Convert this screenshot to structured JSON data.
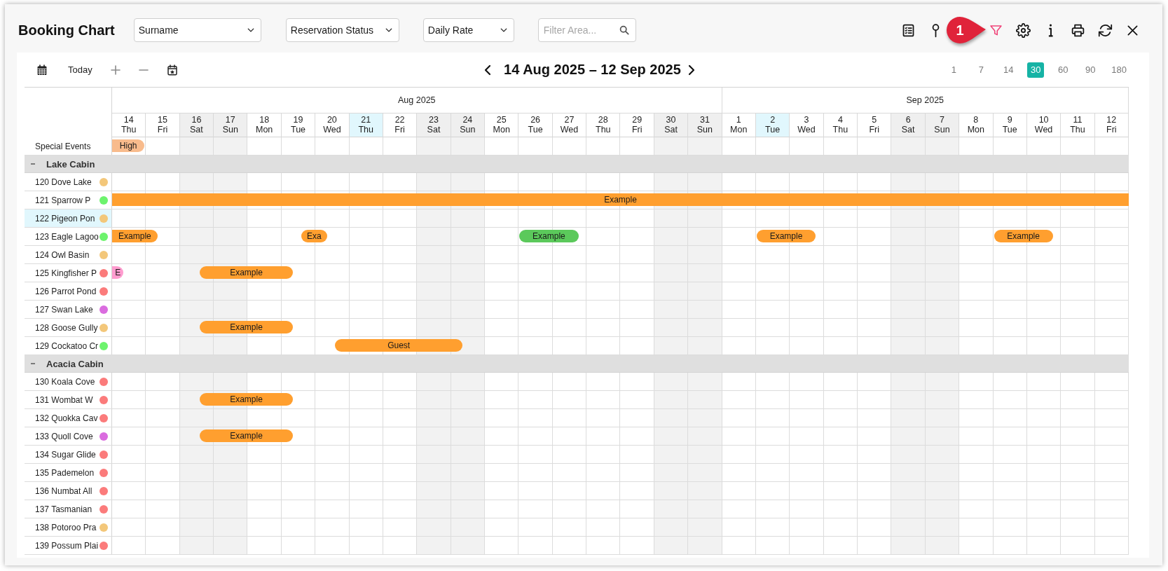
{
  "header": {
    "title": "Booking Chart",
    "dropdowns": [
      {
        "value": "Surname"
      },
      {
        "value": "Reservation Status"
      },
      {
        "value": "Daily Rate"
      }
    ],
    "filter": {
      "placeholder": "Filter Area..."
    },
    "tools": [
      {
        "kind": "checklist",
        "active": false
      },
      {
        "kind": "pin",
        "active": false
      },
      {
        "kind": "filter",
        "active": true,
        "callout": "1"
      },
      {
        "kind": "settings",
        "active": false
      },
      {
        "kind": "info",
        "active": false
      },
      {
        "kind": "print",
        "active": false
      },
      {
        "kind": "refresh",
        "active": false
      },
      {
        "kind": "close",
        "active": false
      }
    ]
  },
  "toolbar": {
    "today": "Today",
    "range": "14 Aug 2025 – 12 Sep 2025",
    "spans": [
      {
        "label": "1",
        "selected": false
      },
      {
        "label": "7",
        "selected": false
      },
      {
        "label": "14",
        "selected": false
      },
      {
        "label": "30",
        "selected": true
      },
      {
        "label": "60",
        "selected": false
      },
      {
        "label": "90",
        "selected": false
      },
      {
        "label": "180",
        "selected": false
      }
    ]
  },
  "chart": {
    "months": [
      {
        "label": "Aug 2025",
        "days": [
          {
            "day": "14",
            "weekday": "Thu",
            "weekend": false,
            "highlighted": false
          },
          {
            "day": "15",
            "weekday": "Fri",
            "weekend": false,
            "highlighted": false
          },
          {
            "day": "16",
            "weekday": "Sat",
            "weekend": true,
            "highlighted": false
          },
          {
            "day": "17",
            "weekday": "Sun",
            "weekend": true,
            "highlighted": false
          },
          {
            "day": "18",
            "weekday": "Mon",
            "weekend": false,
            "highlighted": false
          },
          {
            "day": "19",
            "weekday": "Tue",
            "weekend": false,
            "highlighted": false
          },
          {
            "day": "20",
            "weekday": "Wed",
            "weekend": false,
            "highlighted": false
          },
          {
            "day": "21",
            "weekday": "Thu",
            "weekend": false,
            "highlighted": true
          },
          {
            "day": "22",
            "weekday": "Fri",
            "weekend": false,
            "highlighted": false
          },
          {
            "day": "23",
            "weekday": "Sat",
            "weekend": true,
            "highlighted": false
          },
          {
            "day": "24",
            "weekday": "Sun",
            "weekend": true,
            "highlighted": false
          },
          {
            "day": "25",
            "weekday": "Mon",
            "weekend": false,
            "highlighted": false
          },
          {
            "day": "26",
            "weekday": "Tue",
            "weekend": false,
            "highlighted": false
          },
          {
            "day": "27",
            "weekday": "Wed",
            "weekend": false,
            "highlighted": false
          },
          {
            "day": "28",
            "weekday": "Thu",
            "weekend": false,
            "highlighted": false
          },
          {
            "day": "29",
            "weekday": "Fri",
            "weekend": false,
            "highlighted": false
          },
          {
            "day": "30",
            "weekday": "Sat",
            "weekend": true,
            "highlighted": false
          },
          {
            "day": "31",
            "weekday": "Sun",
            "weekend": true,
            "highlighted": false
          }
        ]
      },
      {
        "label": "Sep 2025",
        "days": [
          {
            "day": "1",
            "weekday": "Mon",
            "weekend": false,
            "highlighted": false
          },
          {
            "day": "2",
            "weekday": "Tue",
            "weekend": false,
            "highlighted": true
          },
          {
            "day": "3",
            "weekday": "Wed",
            "weekend": false,
            "highlighted": false
          },
          {
            "day": "4",
            "weekday": "Thu",
            "weekend": false,
            "highlighted": false
          },
          {
            "day": "5",
            "weekday": "Fri",
            "weekend": false,
            "highlighted": false
          },
          {
            "day": "6",
            "weekday": "Sat",
            "weekend": true,
            "highlighted": false
          },
          {
            "day": "7",
            "weekday": "Sun",
            "weekend": true,
            "highlighted": false
          },
          {
            "day": "8",
            "weekday": "Mon",
            "weekend": false,
            "highlighted": false
          },
          {
            "day": "9",
            "weekday": "Tue",
            "weekend": false,
            "highlighted": false
          },
          {
            "day": "10",
            "weekday": "Wed",
            "weekend": false,
            "highlighted": false
          },
          {
            "day": "11",
            "weekday": "Thu",
            "weekend": false,
            "highlighted": false
          },
          {
            "day": "12",
            "weekday": "Fri",
            "weekend": false,
            "highlighted": false
          }
        ]
      }
    ],
    "special_events": {
      "label": "Special Events",
      "cells": [
        {
          "kind": "day_end",
          "label": "High",
          "color": "#f8bb8c"
        },
        {
          "kind": "free"
        },
        {
          "kind": "free"
        },
        {
          "kind": "free"
        },
        {
          "kind": "free"
        },
        {
          "kind": "free"
        },
        {
          "kind": "free"
        },
        {
          "kind": "free"
        },
        {
          "kind": "free"
        },
        {
          "kind": "free"
        },
        {
          "kind": "free"
        },
        {
          "kind": "free"
        },
        {
          "kind": "free"
        },
        {
          "kind": "free"
        },
        {
          "kind": "free"
        },
        {
          "kind": "free"
        },
        {
          "kind": "free"
        },
        {
          "kind": "free"
        },
        {
          "kind": "free"
        },
        {
          "kind": "free"
        },
        {
          "kind": "free"
        },
        {
          "kind": "free"
        },
        {
          "kind": "free"
        },
        {
          "kind": "free"
        },
        {
          "kind": "free"
        },
        {
          "kind": "free"
        },
        {
          "kind": "free"
        },
        {
          "kind": "free"
        },
        {
          "kind": "free"
        },
        {
          "kind": "free"
        }
      ]
    },
    "groups": [
      {
        "name": "Lake Cabin",
        "expanded": true,
        "rooms": [
          {
            "name": "120 Dove Lake",
            "color": "#f3c77a",
            "selected": false
          },
          {
            "name": "121 Sparrow P",
            "color": "#6df36d",
            "selected": false,
            "cells": [
              {
                "kind": "stay",
                "label": "Example",
                "color": "#ff9f2f"
              },
              {
                "kind": "stay"
              },
              {
                "kind": "stay"
              },
              {
                "kind": "stay"
              },
              {
                "kind": "stay"
              },
              {
                "kind": "stay"
              },
              {
                "kind": "stay"
              },
              {
                "kind": "stay"
              },
              {
                "kind": "stay"
              },
              {
                "kind": "stay"
              },
              {
                "kind": "stay"
              },
              {
                "kind": "stay"
              },
              {
                "kind": "stay"
              },
              {
                "kind": "stay"
              },
              {
                "kind": "stay"
              },
              {
                "kind": "stay"
              },
              {
                "kind": "stay"
              },
              {
                "kind": "stay"
              },
              {
                "kind": "stay"
              },
              {
                "kind": "stay"
              },
              {
                "kind": "stay"
              },
              {
                "kind": "stay"
              },
              {
                "kind": "stay"
              },
              {
                "kind": "stay"
              },
              {
                "kind": "stay"
              },
              {
                "kind": "stay"
              },
              {
                "kind": "stay"
              },
              {
                "kind": "stay"
              },
              {
                "kind": "stay"
              },
              {
                "kind": "stay"
              }
            ]
          },
          {
            "name": "122 Pigeon Pon",
            "color": "#f3c77a",
            "selected": true
          },
          {
            "name": "123 Eagle Lagoo",
            "color": "#6df36d",
            "selected": false,
            "cells": [
              {
                "kind": "stay",
                "label": "Example",
                "color": "#ff9f2f"
              },
              {
                "kind": "departure"
              },
              {
                "kind": "free"
              },
              {
                "kind": "free"
              },
              {
                "kind": "free"
              },
              {
                "kind": "arrival",
                "label": "Exa",
                "color": "#ff9f2f"
              },
              {
                "kind": "departure"
              },
              {
                "kind": "free"
              },
              {
                "kind": "free"
              },
              {
                "kind": "free"
              },
              {
                "kind": "free"
              },
              {
                "kind": "free"
              },
              {
                "kind": "early_arrival",
                "label": "Example",
                "color": "#5bc95b"
              },
              {
                "kind": "late_departure"
              },
              {
                "kind": "free"
              },
              {
                "kind": "free"
              },
              {
                "kind": "free"
              },
              {
                "kind": "free"
              },
              {
                "kind": "free"
              },
              {
                "kind": "early_arrival",
                "label": "Example",
                "color": "#ff9f2f"
              },
              {
                "kind": "late_departure"
              },
              {
                "kind": "free"
              },
              {
                "kind": "free"
              },
              {
                "kind": "free"
              },
              {
                "kind": "free"
              },
              {
                "kind": "free"
              },
              {
                "kind": "early_arrival",
                "label": "Example",
                "color": "#ff9f2f"
              },
              {
                "kind": "late_departure"
              },
              {
                "kind": "free"
              },
              {
                "kind": "free"
              }
            ]
          },
          {
            "name": "124 Owl Basin",
            "color": "#f3c77a",
            "selected": false
          },
          {
            "name": "125 Kingfisher P",
            "color": "#fb7b7b",
            "selected": false,
            "cells": [
              {
                "kind": "departure",
                "label": "E",
                "color": "#ff9ccf"
              },
              {
                "kind": "free"
              },
              {
                "kind": "arrival",
                "label": "Example",
                "color": "#ff9f2f"
              },
              {
                "kind": "stay"
              },
              {
                "kind": "stay"
              },
              {
                "kind": "departure"
              },
              {
                "kind": "free"
              },
              {
                "kind": "free"
              },
              {
                "kind": "free"
              },
              {
                "kind": "free"
              },
              {
                "kind": "free"
              },
              {
                "kind": "free"
              },
              {
                "kind": "free"
              },
              {
                "kind": "free"
              },
              {
                "kind": "free"
              },
              {
                "kind": "free"
              },
              {
                "kind": "free"
              },
              {
                "kind": "free"
              },
              {
                "kind": "free"
              },
              {
                "kind": "free"
              },
              {
                "kind": "free"
              },
              {
                "kind": "free"
              },
              {
                "kind": "free"
              },
              {
                "kind": "free"
              },
              {
                "kind": "free"
              },
              {
                "kind": "free"
              },
              {
                "kind": "free"
              },
              {
                "kind": "free"
              },
              {
                "kind": "free"
              },
              {
                "kind": "free"
              }
            ]
          },
          {
            "name": "126 Parrot Pond",
            "color": "#fb7b7b",
            "selected": false
          },
          {
            "name": "127 Swan Lake",
            "color": "#da6cdf",
            "selected": false
          },
          {
            "name": "128 Goose Gully",
            "color": "#f3c77a",
            "selected": false,
            "cells": [
              {
                "kind": "free"
              },
              {
                "kind": "free"
              },
              {
                "kind": "arrival",
                "label": "Example",
                "color": "#ff9f2f"
              },
              {
                "kind": "stay"
              },
              {
                "kind": "stay"
              },
              {
                "kind": "departure"
              },
              {
                "kind": "free"
              },
              {
                "kind": "free"
              },
              {
                "kind": "free"
              },
              {
                "kind": "free"
              },
              {
                "kind": "free"
              },
              {
                "kind": "free"
              },
              {
                "kind": "free"
              },
              {
                "kind": "free"
              },
              {
                "kind": "free"
              },
              {
                "kind": "free"
              },
              {
                "kind": "free"
              },
              {
                "kind": "free"
              },
              {
                "kind": "free"
              },
              {
                "kind": "free"
              },
              {
                "kind": "free"
              },
              {
                "kind": "free"
              },
              {
                "kind": "free"
              },
              {
                "kind": "free"
              },
              {
                "kind": "free"
              },
              {
                "kind": "free"
              },
              {
                "kind": "free"
              },
              {
                "kind": "free"
              },
              {
                "kind": "free"
              },
              {
                "kind": "free"
              }
            ]
          },
          {
            "name": "129 Cockatoo Cr",
            "color": "#6df36d",
            "selected": false,
            "cells": [
              {
                "kind": "free"
              },
              {
                "kind": "free"
              },
              {
                "kind": "free"
              },
              {
                "kind": "free"
              },
              {
                "kind": "free"
              },
              {
                "kind": "free"
              },
              {
                "kind": "arrival",
                "label": "Guest",
                "color": "#ff9f2f"
              },
              {
                "kind": "stay"
              },
              {
                "kind": "stay"
              },
              {
                "kind": "stay"
              },
              {
                "kind": "departure"
              },
              {
                "kind": "free"
              },
              {
                "kind": "free"
              },
              {
                "kind": "free"
              },
              {
                "kind": "free"
              },
              {
                "kind": "free"
              },
              {
                "kind": "free"
              },
              {
                "kind": "free"
              },
              {
                "kind": "free"
              },
              {
                "kind": "free"
              },
              {
                "kind": "free"
              },
              {
                "kind": "free"
              },
              {
                "kind": "free"
              },
              {
                "kind": "free"
              },
              {
                "kind": "free"
              },
              {
                "kind": "free"
              },
              {
                "kind": "free"
              },
              {
                "kind": "free"
              },
              {
                "kind": "free"
              },
              {
                "kind": "free"
              }
            ]
          }
        ]
      },
      {
        "name": "Acacia Cabin",
        "expanded": true,
        "rooms": [
          {
            "name": "130 Koala Cove",
            "color": "#fb7b7b",
            "selected": false
          },
          {
            "name": "131 Wombat W",
            "color": "#fb7b7b",
            "selected": false,
            "cells": [
              {
                "kind": "free"
              },
              {
                "kind": "free"
              },
              {
                "kind": "arrival",
                "label": "Example",
                "color": "#ff9f2f"
              },
              {
                "kind": "stay"
              },
              {
                "kind": "stay"
              },
              {
                "kind": "departure"
              },
              {
                "kind": "free"
              },
              {
                "kind": "free"
              },
              {
                "kind": "free"
              },
              {
                "kind": "free"
              },
              {
                "kind": "free"
              },
              {
                "kind": "free"
              },
              {
                "kind": "free"
              },
              {
                "kind": "free"
              },
              {
                "kind": "free"
              },
              {
                "kind": "free"
              },
              {
                "kind": "free"
              },
              {
                "kind": "free"
              },
              {
                "kind": "free"
              },
              {
                "kind": "free"
              },
              {
                "kind": "free"
              },
              {
                "kind": "free"
              },
              {
                "kind": "free"
              },
              {
                "kind": "free"
              },
              {
                "kind": "free"
              },
              {
                "kind": "free"
              },
              {
                "kind": "free"
              },
              {
                "kind": "free"
              },
              {
                "kind": "free"
              },
              {
                "kind": "free"
              }
            ]
          },
          {
            "name": "132 Quokka Cav",
            "color": "#fb7b7b",
            "selected": false
          },
          {
            "name": "133 Quoll Cove",
            "color": "#da6cdf",
            "selected": false,
            "cells": [
              {
                "kind": "free"
              },
              {
                "kind": "free"
              },
              {
                "kind": "arrival",
                "label": "Example",
                "color": "#ff9f2f"
              },
              {
                "kind": "stay"
              },
              {
                "kind": "stay"
              },
              {
                "kind": "departure"
              },
              {
                "kind": "free"
              },
              {
                "kind": "free"
              },
              {
                "kind": "free"
              },
              {
                "kind": "free"
              },
              {
                "kind": "free"
              },
              {
                "kind": "free"
              },
              {
                "kind": "free"
              },
              {
                "kind": "free"
              },
              {
                "kind": "free"
              },
              {
                "kind": "free"
              },
              {
                "kind": "free"
              },
              {
                "kind": "free"
              },
              {
                "kind": "free"
              },
              {
                "kind": "free"
              },
              {
                "kind": "free"
              },
              {
                "kind": "free"
              },
              {
                "kind": "free"
              },
              {
                "kind": "free"
              },
              {
                "kind": "free"
              },
              {
                "kind": "free"
              },
              {
                "kind": "free"
              },
              {
                "kind": "free"
              },
              {
                "kind": "free"
              },
              {
                "kind": "free"
              }
            ]
          },
          {
            "name": "134 Sugar Glide",
            "color": "#fb7b7b",
            "selected": false
          },
          {
            "name": "135 Pademelon",
            "color": "#fb7b7b",
            "selected": false
          },
          {
            "name": "136 Numbat All",
            "color": "#fb7b7b",
            "selected": false
          },
          {
            "name": "137 Tasmanian",
            "color": "#fb7b7b",
            "selected": false
          },
          {
            "name": "138 Potoroo Pra",
            "color": "#f3c77a",
            "selected": false
          },
          {
            "name": "139 Possum Plai",
            "color": "#fb7b7b",
            "selected": false
          }
        ]
      }
    ]
  }
}
